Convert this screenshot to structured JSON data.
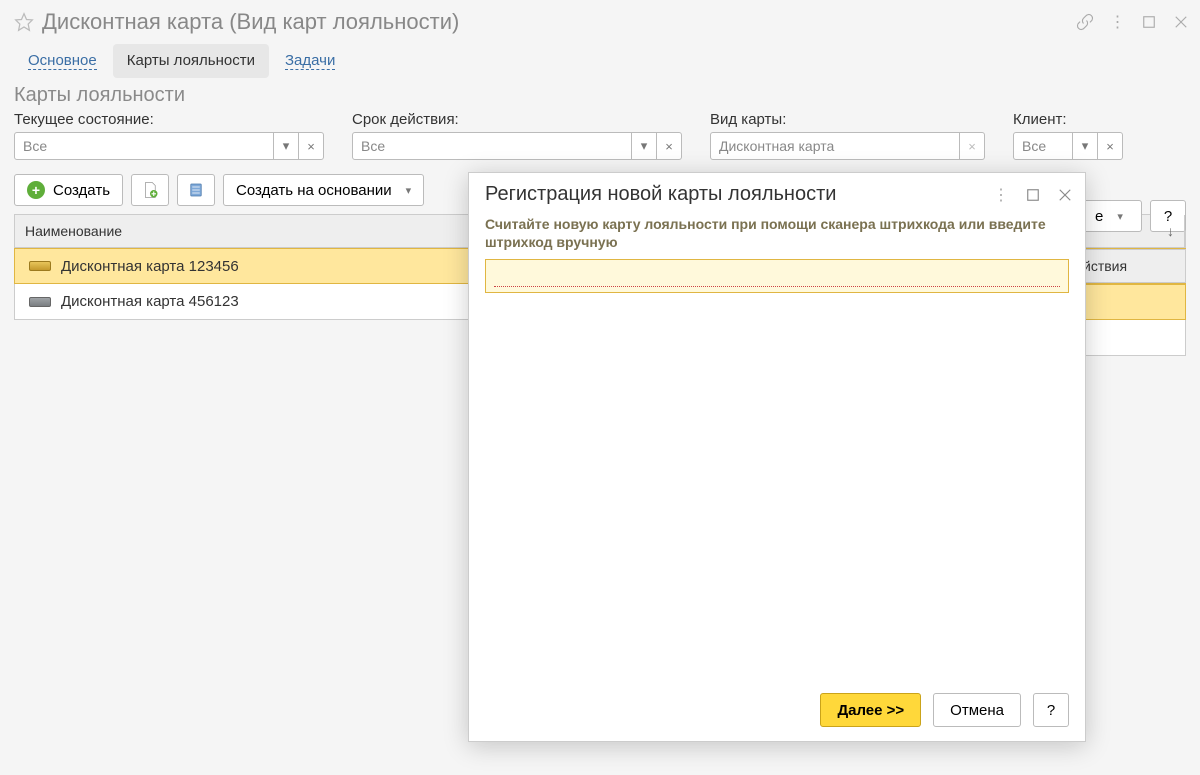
{
  "window": {
    "title": "Дисконтная карта (Вид карт лояльности)"
  },
  "tabs": {
    "main": "Основное",
    "cards": "Карты лояльности",
    "tasks": "Задачи"
  },
  "section": {
    "title": "Карты лояльности"
  },
  "filters": {
    "state": {
      "label": "Текущее состояние:",
      "value": "Все"
    },
    "expiry": {
      "label": "Срок действия:",
      "value": "Все"
    },
    "cardtype": {
      "label": "Вид карты:",
      "value": "Дисконтная карта"
    },
    "client": {
      "label": "Клиент:",
      "value": "Все"
    }
  },
  "toolbar": {
    "create": "Создать",
    "create_based": "Создать на основании",
    "more": "е",
    "help": "?"
  },
  "grid": {
    "col_name": "Наименование",
    "col_right": "йствия",
    "rows": [
      {
        "text": "Дисконтная карта 123456",
        "selected": true
      },
      {
        "text": "Дисконтная карта 456123",
        "selected": false
      }
    ]
  },
  "modal": {
    "title": "Регистрация новой карты лояльности",
    "instructions": "Считайте новую карту лояльности при помощи сканера штрихкода или введите штрихкод вручную",
    "value": "",
    "next": "Далее >>",
    "cancel": "Отмена",
    "help": "?"
  }
}
